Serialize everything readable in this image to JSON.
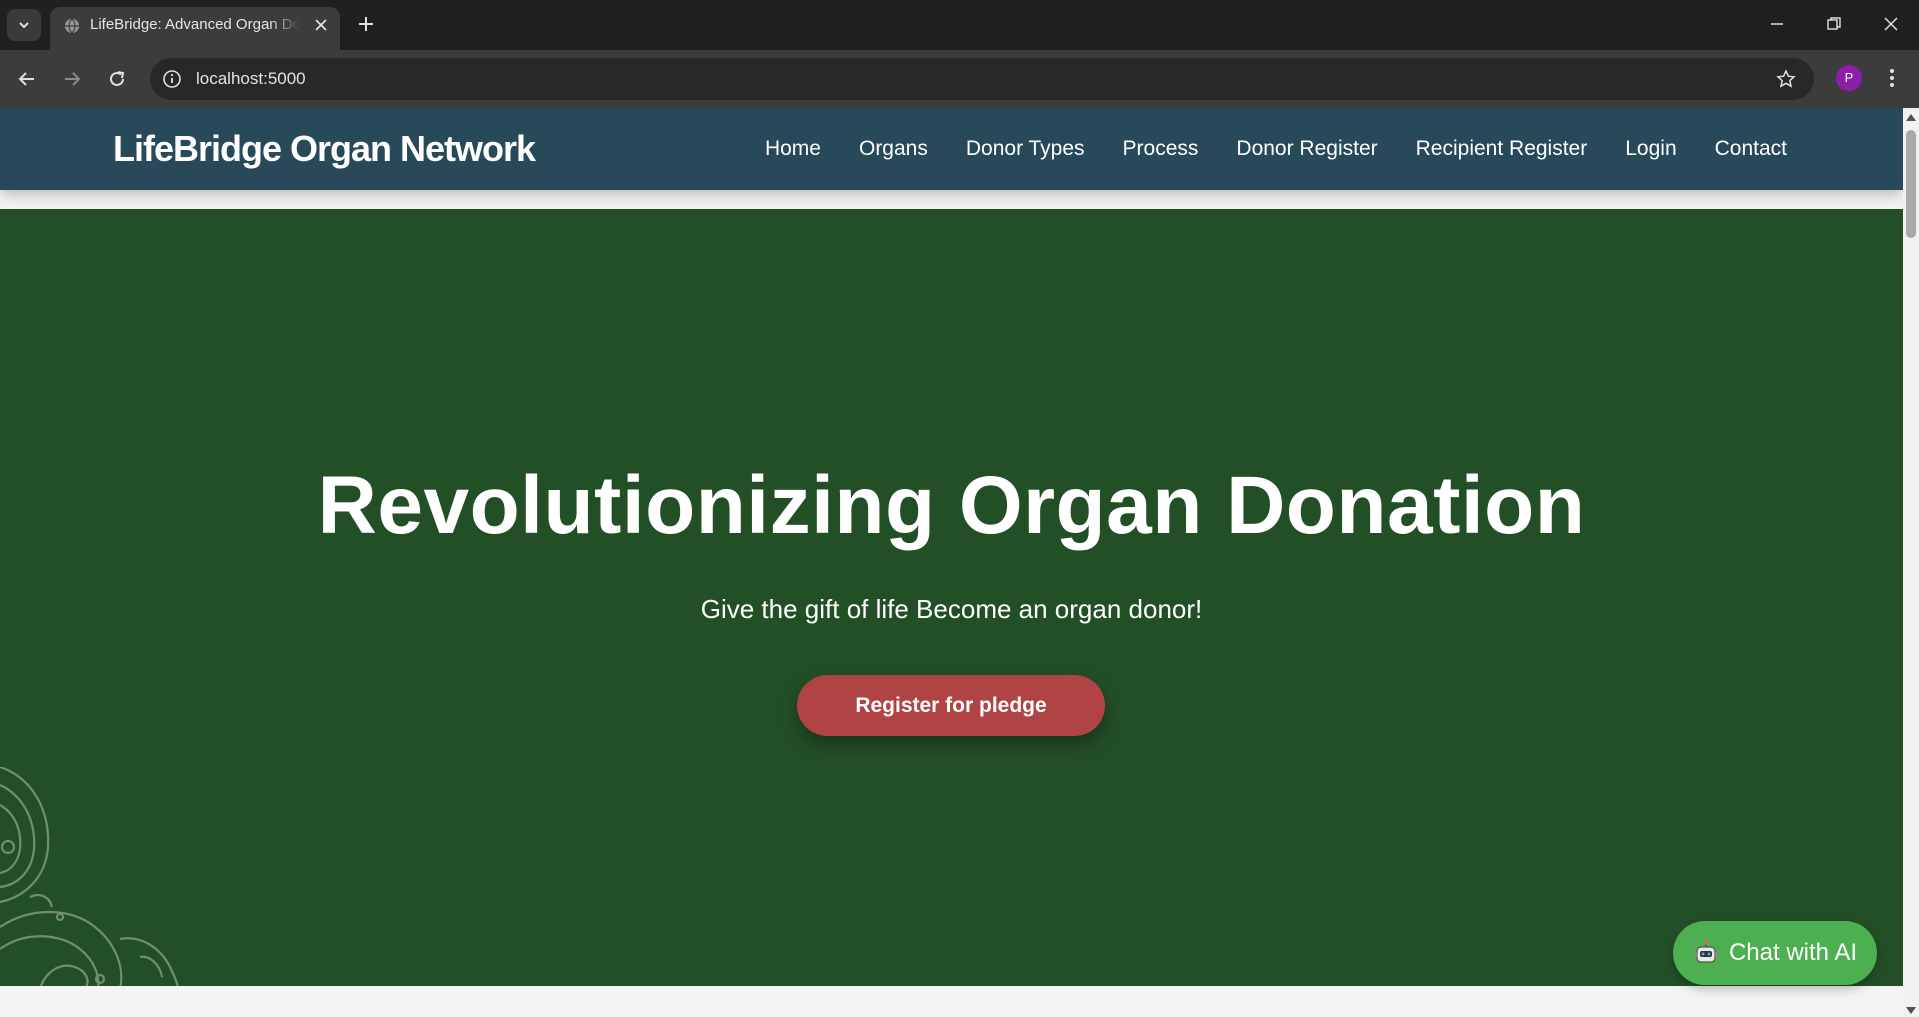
{
  "browser": {
    "tab_title": "LifeBridge: Advanced Organ Donation",
    "url": "localhost:5000",
    "profile_initial": "P"
  },
  "site": {
    "brand": "LifeBridge Organ Network",
    "nav": [
      {
        "label": "Home"
      },
      {
        "label": "Organs"
      },
      {
        "label": "Donor Types"
      },
      {
        "label": "Process"
      },
      {
        "label": "Donor Register"
      },
      {
        "label": "Recipient Register"
      },
      {
        "label": "Login"
      },
      {
        "label": "Contact"
      }
    ]
  },
  "hero": {
    "title": "Revolutionizing Organ Donation",
    "subtitle": "Give the gift of life Become an organ donor!",
    "cta_label": "Register for pledge"
  },
  "chat": {
    "label": "Chat with AI",
    "icon": "robot-icon"
  },
  "colors": {
    "header": "#28495a",
    "hero": "#234f27",
    "cta": "#b04444",
    "chat": "#4caf50"
  }
}
